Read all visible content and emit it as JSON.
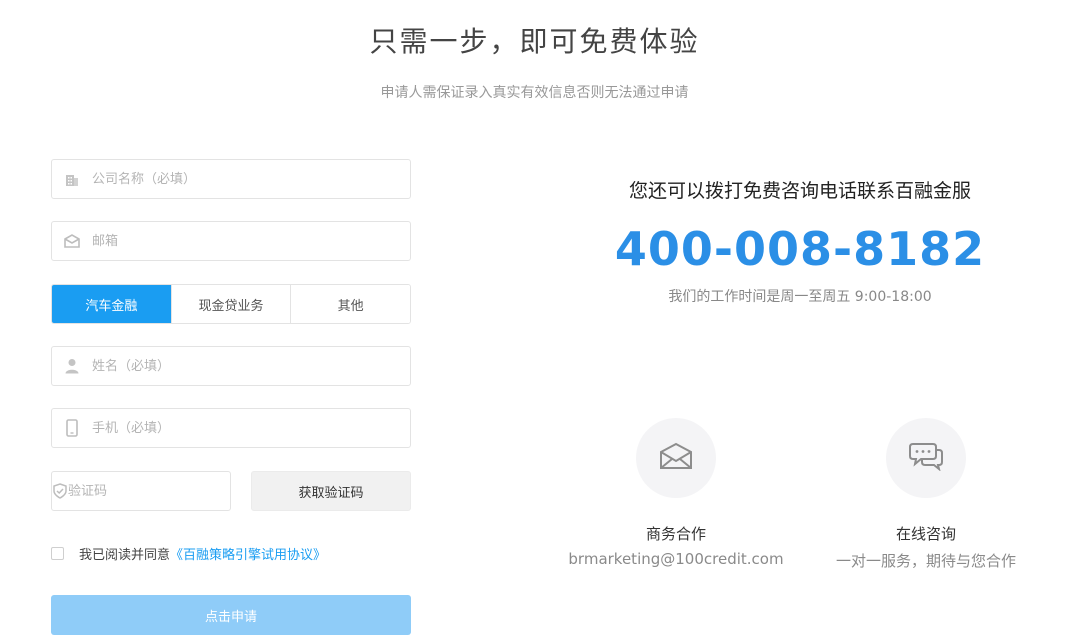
{
  "header": {
    "title": "只需一步，即可免费体验",
    "subtitle": "申请人需保证录入真实有效信息否则无法通过申请"
  },
  "form": {
    "company_placeholder": "公司名称（必填）",
    "email_placeholder": "邮箱",
    "tabs": [
      "汽车金融",
      "现金贷业务",
      "其他"
    ],
    "active_tab": "汽车金融",
    "name_placeholder": "姓名（必填）",
    "phone_placeholder": "手机（必填）",
    "code_placeholder": "验证码",
    "get_code_label": "获取验证码",
    "agree_text": "我已阅读并同意",
    "agreement_link": "《百融策略引擎试用协议》",
    "submit_label": "点击申请"
  },
  "contact": {
    "call_text": "您还可以拨打免费咨询电话联系百融金服",
    "phone": "400-008-8182",
    "hours": "我们的工作时间是周一至周五 9:00-18:00",
    "business": {
      "label": "商务合作",
      "email": "brmarketing@100credit.com"
    },
    "online": {
      "label": "在线咨询",
      "desc": "一对一服务，期待与您合作"
    }
  },
  "colors": {
    "accent": "#1a9df2",
    "phone": "#2b8fe6",
    "submit_disabled": "#8fccf8"
  },
  "icons": {
    "company": "building-icon",
    "email": "envelope-icon",
    "name": "user-icon",
    "phone": "mobile-icon",
    "code": "shield-icon",
    "business": "mail-icon",
    "online": "chat-icon"
  }
}
